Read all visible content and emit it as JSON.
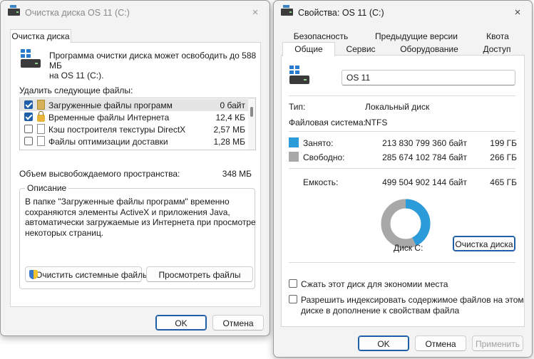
{
  "cleanup": {
    "title": "Очистка диска OS 11 (C:)",
    "close_icon": "×",
    "tab": "Очистка диска",
    "intro": "Программа очистки диска может освободить до 588 МБ\nна OS 11 (C:).",
    "delete_label": "Удалить следующие файлы:",
    "files": [
      {
        "name": "Загруженные файлы программ",
        "size": "0 байт",
        "checked": true,
        "icon": "folder-icon"
      },
      {
        "name": "Временные файлы Интернета",
        "size": "12,4 КБ",
        "checked": true,
        "icon": "lock-icon"
      },
      {
        "name": "Кэш построителя текстуры DirectX",
        "size": "2,57 МБ",
        "checked": false,
        "icon": "document-icon"
      },
      {
        "name": "Файлы оптимизации доставки",
        "size": "1,28 МБ",
        "checked": false,
        "icon": "document-icon"
      }
    ],
    "freed_label": "Объем высвобождаемого пространства:",
    "freed_value": "348 МБ",
    "desc_title": "Описание",
    "desc_text": "В папке \"Загруженные файлы программ\" временно\nсохраняются элементы ActiveX и приложения Java,\nавтоматически загружаемые из Интернета при просмотре\nнекоторых страниц.",
    "clean_system_button": "Очистить системные файлы",
    "view_files_button": "Просмотреть файлы",
    "ok_button": "OK",
    "cancel_button": "Отмена"
  },
  "properties": {
    "title": "Свойства: OS 11 (C:)",
    "close_icon": "×",
    "tabs_row1": [
      "Безопасность",
      "Предыдущие версии",
      "Квота"
    ],
    "tabs_row2": [
      "Общие",
      "Сервис",
      "Оборудование",
      "Доступ"
    ],
    "active_tab": "Общие",
    "drive_name": "OS 11",
    "type_label": "Тип:",
    "type_value": "Локальный диск",
    "fs_label": "Файловая система:",
    "fs_value": "NTFS",
    "used_label": "Занято:",
    "used_bytes": "213 830 799 360 байт",
    "used_gb": "199 ГБ",
    "free_label": "Свободно:",
    "free_bytes": "285 674 102 784 байт",
    "free_gb": "266 ГБ",
    "capacity_label": "Емкость:",
    "capacity_bytes": "499 504 902 144 байт",
    "capacity_gb": "465 ГБ",
    "disk_label": "Диск C:",
    "cleanup_button": "Очистка диска",
    "compress_label": "Сжать этот диск для экономии места",
    "index_label": "Разрешить индексировать содержимое файлов на этом\nдиске в дополнение к свойствам файла",
    "compress_checked": false,
    "index_checked": false,
    "ok_button": "OK",
    "cancel_button": "Отмена",
    "apply_button": "Применить",
    "used_fraction": 0.428,
    "colors": {
      "used": "#2b9bd9",
      "free": "#a8a8a8",
      "accent": "#1f5fa8"
    }
  }
}
